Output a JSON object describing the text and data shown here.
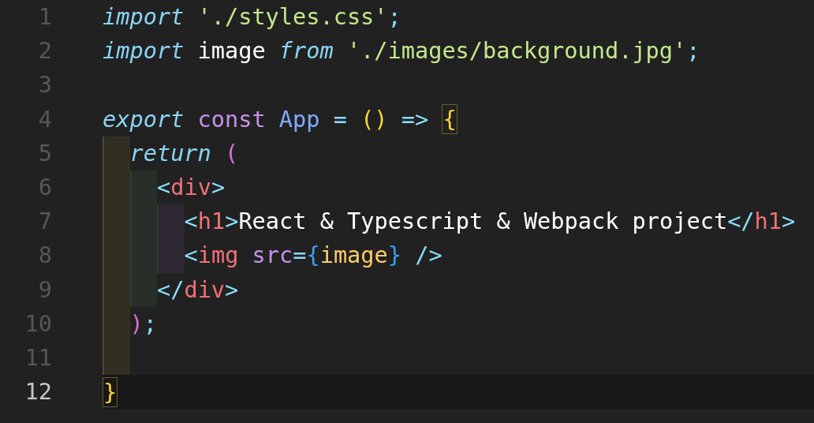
{
  "editor": {
    "lines": [
      {
        "number": "1",
        "current": false,
        "tokens": [
          {
            "t": "import ",
            "kind": "keyword"
          },
          {
            "t": "'./styles.css'",
            "kind": "string"
          },
          {
            "t": ";",
            "kind": "punct"
          }
        ]
      },
      {
        "number": "2",
        "current": false,
        "tokens": [
          {
            "t": "import ",
            "kind": "keyword"
          },
          {
            "t": "image ",
            "kind": "plain"
          },
          {
            "t": "from ",
            "kind": "keyword"
          },
          {
            "t": "'./images/background.jpg'",
            "kind": "string"
          },
          {
            "t": ";",
            "kind": "punct"
          }
        ]
      },
      {
        "number": "3",
        "current": false
      },
      {
        "number": "4",
        "current": false,
        "tokens": [
          {
            "t": "export ",
            "kind": "keyword"
          },
          {
            "t": "const ",
            "kind": "storage"
          },
          {
            "t": "App ",
            "kind": "function"
          },
          {
            "t": "= ",
            "kind": "punct"
          },
          {
            "t": "() ",
            "kind": "paren"
          },
          {
            "t": "=> ",
            "kind": "punct"
          },
          {
            "t": "{",
            "kind": "brace-matched"
          }
        ],
        "children": [
          {
            "number": "5",
            "current": false,
            "tokens": [
              {
                "t": "return ",
                "kind": "keyword"
              },
              {
                "t": "(",
                "kind": "paren-inner"
              }
            ],
            "children": [
              {
                "number": "6",
                "current": false,
                "tokens": [
                  {
                    "t": "<",
                    "kind": "punct"
                  },
                  {
                    "t": "div",
                    "kind": "tag"
                  },
                  {
                    "t": ">",
                    "kind": "punct"
                  }
                ],
                "children": [
                  {
                    "number": "7",
                    "current": false,
                    "tokens": [
                      {
                        "t": "<",
                        "kind": "punct"
                      },
                      {
                        "t": "h1",
                        "kind": "tag"
                      },
                      {
                        "t": ">",
                        "kind": "punct"
                      },
                      {
                        "t": "React & Typescript & Webpack project",
                        "kind": "plain"
                      },
                      {
                        "t": "</",
                        "kind": "punct"
                      },
                      {
                        "t": "h1",
                        "kind": "tag"
                      },
                      {
                        "t": ">",
                        "kind": "punct"
                      }
                    ]
                  },
                  {
                    "number": "8",
                    "current": false,
                    "tokens": [
                      {
                        "t": "<",
                        "kind": "punct"
                      },
                      {
                        "t": "img ",
                        "kind": "tag"
                      },
                      {
                        "t": "src",
                        "kind": "attr"
                      },
                      {
                        "t": "=",
                        "kind": "punct"
                      },
                      {
                        "t": "{",
                        "kind": "jsx-brace"
                      },
                      {
                        "t": "image",
                        "kind": "variable"
                      },
                      {
                        "t": "}",
                        "kind": "jsx-brace"
                      },
                      {
                        "t": " />",
                        "kind": "punct"
                      }
                    ]
                  }
                ]
              },
              {
                "number": "9",
                "current": false,
                "tokens": [
                  {
                    "t": "</",
                    "kind": "punct"
                  },
                  {
                    "t": "div",
                    "kind": "tag"
                  },
                  {
                    "t": ">",
                    "kind": "punct"
                  }
                ]
              }
            ]
          },
          {
            "number": "10",
            "current": false,
            "tokens": [
              {
                "t": ")",
                "kind": "paren-inner"
              },
              {
                "t": ";",
                "kind": "punct"
              }
            ]
          },
          {
            "number": "11",
            "current": false
          }
        ]
      },
      {
        "number": "12",
        "current": true,
        "tokens": [
          {
            "t": "}",
            "kind": "brace-matched"
          }
        ]
      }
    ]
  }
}
